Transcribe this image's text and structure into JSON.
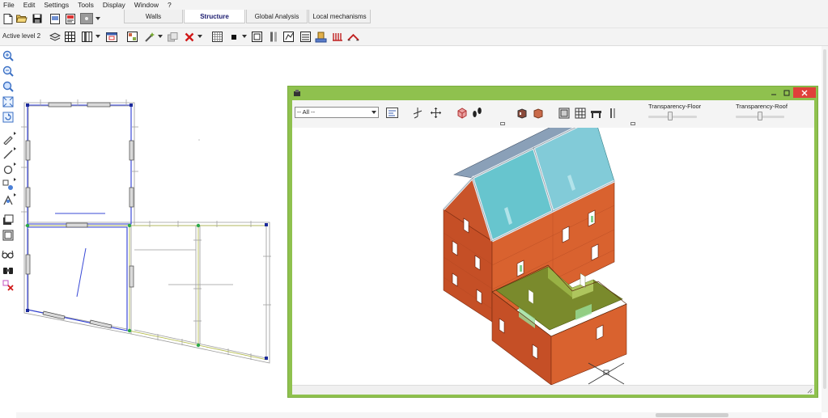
{
  "menu": [
    "File",
    "Edit",
    "Settings",
    "Tools",
    "Display",
    "Window",
    "?"
  ],
  "tabs": [
    {
      "label": "Walls",
      "active": false
    },
    {
      "label": "Structure",
      "active": true
    },
    {
      "label": "Global Analysis",
      "active": false
    },
    {
      "label": "Local mechanisms",
      "active": false
    }
  ],
  "toolbar2": {
    "active_level": "Active level  2"
  },
  "view3d": {
    "filter_value": "-- All --",
    "transparency_floor_label": "Transparency-Floor",
    "transparency_roof_label": "Transparency-Roof",
    "transparency_floor_value": 0.45,
    "transparency_roof_value": 0.5
  },
  "colors": {
    "accent": "#8fc14e",
    "close_button": "#e0403a",
    "wall_brick": "#d4552c",
    "floor_green": "#7a8a2c",
    "roof_glass": "#4fb9c4"
  }
}
